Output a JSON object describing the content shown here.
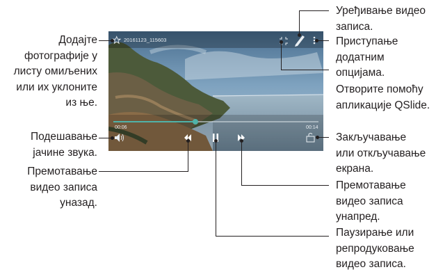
{
  "video": {
    "filename": "20161123_115603",
    "time_elapsed": "00:06",
    "time_total": "00:14",
    "progress_fraction": 0.4
  },
  "callouts": {
    "favorites": [
      "Додајте",
      "фотографије у",
      "листу омиљених",
      "или их уклоните",
      "из ње."
    ],
    "volume": [
      "Подешавање",
      "јачине звука."
    ],
    "rewind": [
      "Премотавање",
      "видео записа",
      "уназад."
    ],
    "edit": [
      "Уређивање видео",
      "записа."
    ],
    "more_options": [
      "Приступање",
      "додатним",
      "опцијама."
    ],
    "qslide": [
      "Отворите помоћу",
      "апликације QSlide."
    ],
    "lock": [
      "Закључавање",
      "или откључавање",
      "екрана."
    ],
    "forward": [
      "Премотавање",
      "видео записа",
      "унапред."
    ],
    "pause": [
      "Паузирање или",
      "репродуковање",
      "видео записа."
    ]
  },
  "colors": {
    "accent": "#4fb3a9",
    "leader": "#231f20"
  }
}
